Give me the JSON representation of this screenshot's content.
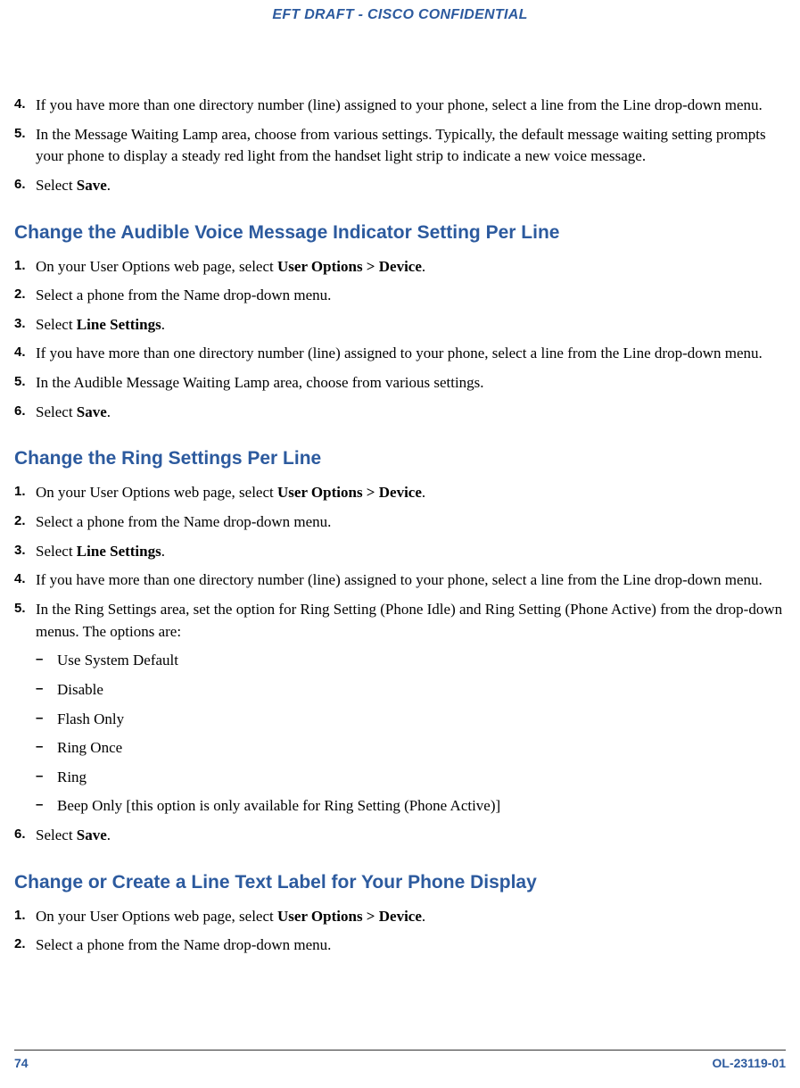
{
  "header": "EFT DRAFT - CISCO CONFIDENTIAL",
  "sections": [
    {
      "steps": [
        {
          "num": "4.",
          "parts": [
            {
              "t": "If you have more than one directory number (line) assigned to your phone, select a line from the Line drop-down menu."
            }
          ]
        },
        {
          "num": "5.",
          "parts": [
            {
              "t": "In the Message Waiting Lamp area, choose from various settings. Typically, the default message waiting setting prompts your phone to display a steady red light from the handset light strip to indicate a new voice message."
            }
          ]
        },
        {
          "num": "6.",
          "parts": [
            {
              "t": "Select "
            },
            {
              "t": "Save",
              "b": true
            },
            {
              "t": "."
            }
          ]
        }
      ]
    },
    {
      "heading": "Change the Audible Voice Message Indicator Setting Per Line",
      "steps": [
        {
          "num": "1.",
          "parts": [
            {
              "t": "On your User Options web page, select "
            },
            {
              "t": "User Options > Device",
              "b": true
            },
            {
              "t": "."
            }
          ]
        },
        {
          "num": "2.",
          "parts": [
            {
              "t": "Select a phone from the Name drop-down menu."
            }
          ]
        },
        {
          "num": "3.",
          "parts": [
            {
              "t": "Select "
            },
            {
              "t": "Line Settings",
              "b": true
            },
            {
              "t": "."
            }
          ]
        },
        {
          "num": "4.",
          "parts": [
            {
              "t": "If you have more than one directory number (line) assigned to your phone, select a line from the Line drop-down menu."
            }
          ]
        },
        {
          "num": "5.",
          "parts": [
            {
              "t": "In the Audible Message Waiting Lamp area, choose from various settings."
            }
          ]
        },
        {
          "num": "6.",
          "parts": [
            {
              "t": "Select "
            },
            {
              "t": "Save",
              "b": true
            },
            {
              "t": "."
            }
          ]
        }
      ]
    },
    {
      "heading": "Change the Ring Settings Per Line",
      "steps": [
        {
          "num": "1.",
          "parts": [
            {
              "t": "On your User Options web page, select "
            },
            {
              "t": "User Options > Device",
              "b": true
            },
            {
              "t": "."
            }
          ]
        },
        {
          "num": "2.",
          "parts": [
            {
              "t": "Select a phone from the Name drop-down menu."
            }
          ]
        },
        {
          "num": "3.",
          "parts": [
            {
              "t": "Select "
            },
            {
              "t": "Line Settings",
              "b": true
            },
            {
              "t": "."
            }
          ]
        },
        {
          "num": "4.",
          "parts": [
            {
              "t": "If you have more than one directory number (line) assigned to your phone, select a line from the Line drop-down menu."
            }
          ]
        },
        {
          "num": "5.",
          "parts": [
            {
              "t": "In the Ring Settings area, set the option for Ring Setting (Phone Idle) and Ring Setting (Phone Active) from the drop-down menus. The options are:"
            }
          ],
          "sub": [
            "Use System Default",
            "Disable",
            "Flash Only",
            "Ring Once",
            "Ring",
            "Beep Only [this option is only available for Ring Setting (Phone Active)]"
          ]
        },
        {
          "num": "6.",
          "parts": [
            {
              "t": "Select "
            },
            {
              "t": "Save",
              "b": true
            },
            {
              "t": "."
            }
          ]
        }
      ]
    },
    {
      "heading": "Change or Create a Line Text Label for Your Phone Display",
      "steps": [
        {
          "num": "1.",
          "parts": [
            {
              "t": "On your User Options web page, select "
            },
            {
              "t": "User Options > Device",
              "b": true
            },
            {
              "t": "."
            }
          ]
        },
        {
          "num": "2.",
          "parts": [
            {
              "t": "Select a phone from the Name drop-down menu."
            }
          ]
        }
      ]
    }
  ],
  "footer": {
    "page": "74",
    "docid": "OL-23119-01"
  }
}
